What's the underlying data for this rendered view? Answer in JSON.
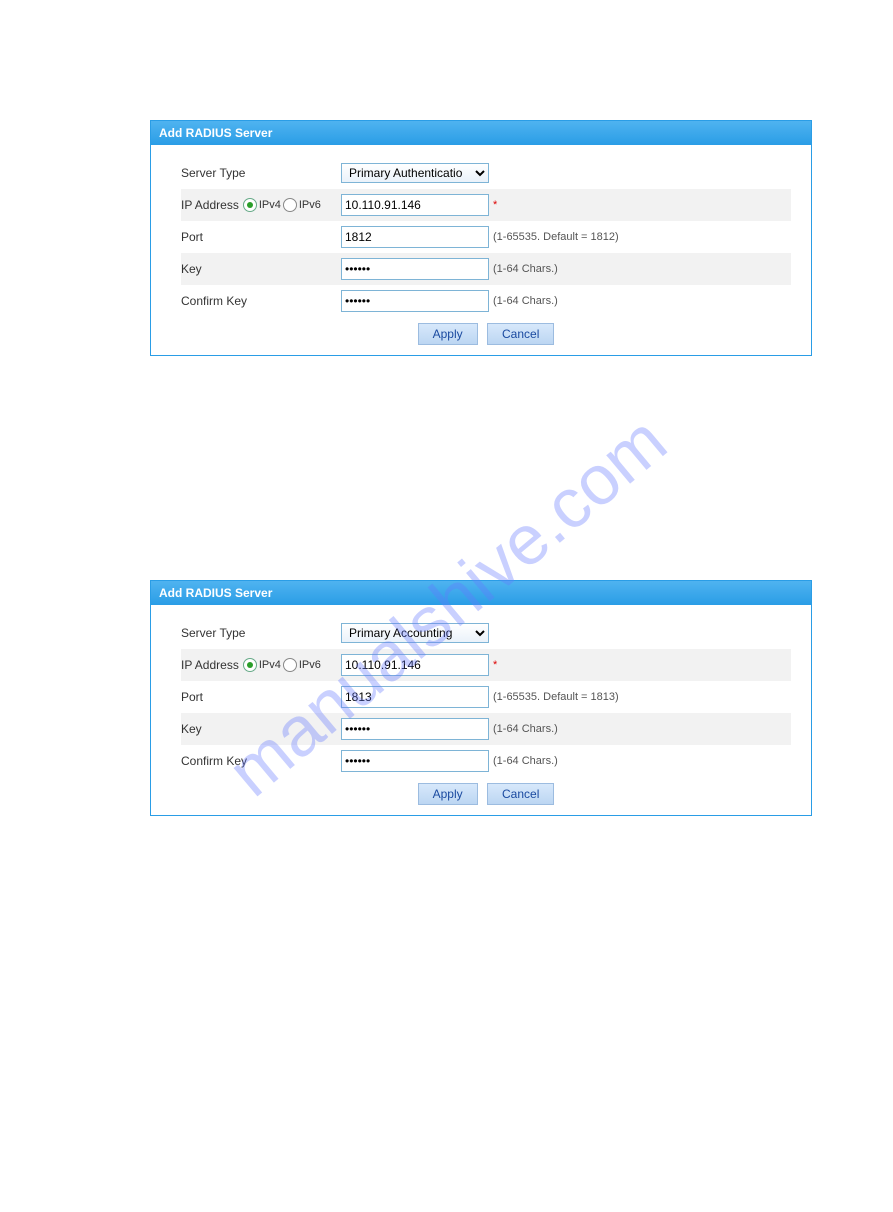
{
  "watermark": "manualshive.com",
  "panels": [
    {
      "title": "Add RADIUS Server",
      "serverType": {
        "label": "Server Type",
        "value": "Primary Authenticatio"
      },
      "ipAddress": {
        "label": "IP Address",
        "ipv4": "IPv4",
        "ipv6": "IPv6",
        "value": "10.110.91.146",
        "required": "*"
      },
      "port": {
        "label": "Port",
        "value": "1812",
        "hint": "(1-65535. Default = 1812)"
      },
      "key": {
        "label": "Key",
        "value": "••••••",
        "hint": "(1-64 Chars.)"
      },
      "confirmKey": {
        "label": "Confirm Key",
        "value": "••••••",
        "hint": "(1-64 Chars.)"
      },
      "buttons": {
        "apply": "Apply",
        "cancel": "Cancel"
      }
    },
    {
      "title": "Add RADIUS Server",
      "serverType": {
        "label": "Server Type",
        "value": "Primary Accounting"
      },
      "ipAddress": {
        "label": "IP Address",
        "ipv4": "IPv4",
        "ipv6": "IPv6",
        "value": "10.110.91.146",
        "required": "*"
      },
      "port": {
        "label": "Port",
        "value": "1813",
        "hint": "(1-65535. Default = 1813)"
      },
      "key": {
        "label": "Key",
        "value": "••••••",
        "hint": "(1-64 Chars.)"
      },
      "confirmKey": {
        "label": "Confirm Key",
        "value": "••••••",
        "hint": "(1-64 Chars.)"
      },
      "buttons": {
        "apply": "Apply",
        "cancel": "Cancel"
      }
    }
  ]
}
